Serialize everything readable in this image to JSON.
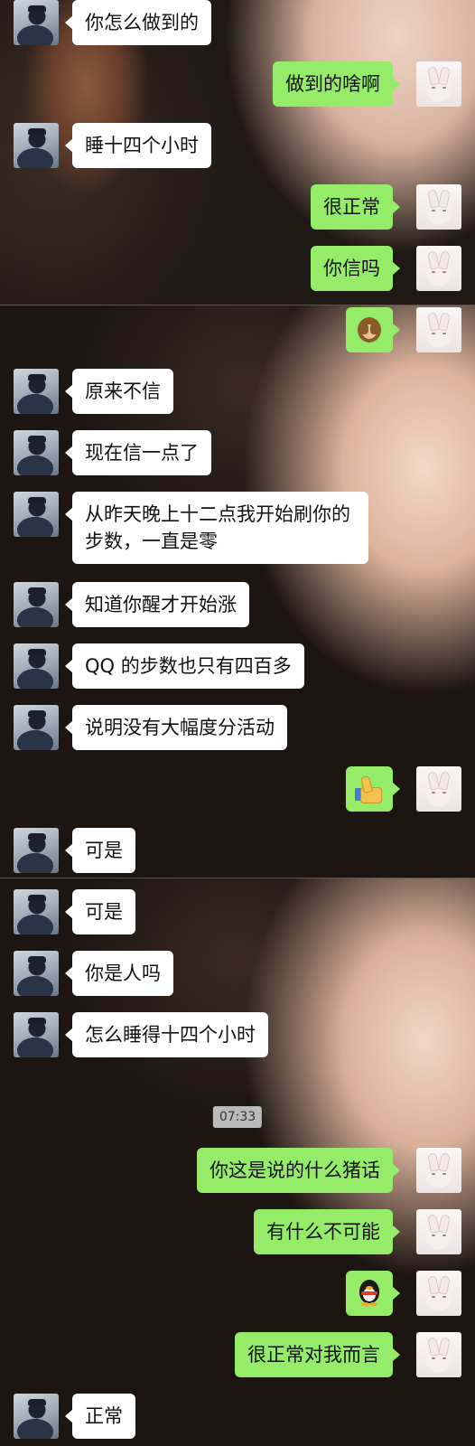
{
  "panels": [
    {
      "messages": [
        {
          "side": "left",
          "text": "你怎么做到的"
        },
        {
          "side": "right",
          "text": "做到的啥啊"
        },
        {
          "side": "left",
          "text": "睡十四个小时"
        },
        {
          "side": "right",
          "text": "很正常"
        },
        {
          "side": "right",
          "text": "你信吗"
        }
      ]
    },
    {
      "messages": [
        {
          "side": "right",
          "emoji": "see-no-evil-monkey-icon"
        },
        {
          "side": "left",
          "text": "原来不信"
        },
        {
          "side": "left",
          "text": "现在信一点了"
        },
        {
          "side": "left",
          "text": "从昨天晚上十二点我开始刷你的步数，一直是零"
        },
        {
          "side": "left",
          "text": "知道你醒才开始涨"
        },
        {
          "side": "left",
          "text": "QQ 的步数也只有四百多"
        },
        {
          "side": "left",
          "text": "说明没有大幅度分活动"
        },
        {
          "side": "right",
          "emoji": "thumbs-up-icon"
        },
        {
          "side": "left",
          "text": "可是"
        }
      ]
    },
    {
      "messages": [
        {
          "side": "left",
          "text": "可是"
        },
        {
          "side": "left",
          "text": "你是人吗"
        },
        {
          "side": "left",
          "text": "怎么睡得十四个小时"
        },
        {
          "timestamp": "07:33"
        },
        {
          "side": "right",
          "text": "你这是说的什么猪话"
        },
        {
          "side": "right",
          "text": "有什么不可能"
        },
        {
          "side": "right",
          "emoji": "qq-penguin-icon"
        },
        {
          "side": "right",
          "text": "很正常对我而言"
        },
        {
          "side": "left",
          "text": "正常"
        }
      ]
    }
  ],
  "colors": {
    "sent_bubble": "#95ec69",
    "received_bubble": "#ffffff",
    "timestamp_bg": "#d7d7d7"
  }
}
